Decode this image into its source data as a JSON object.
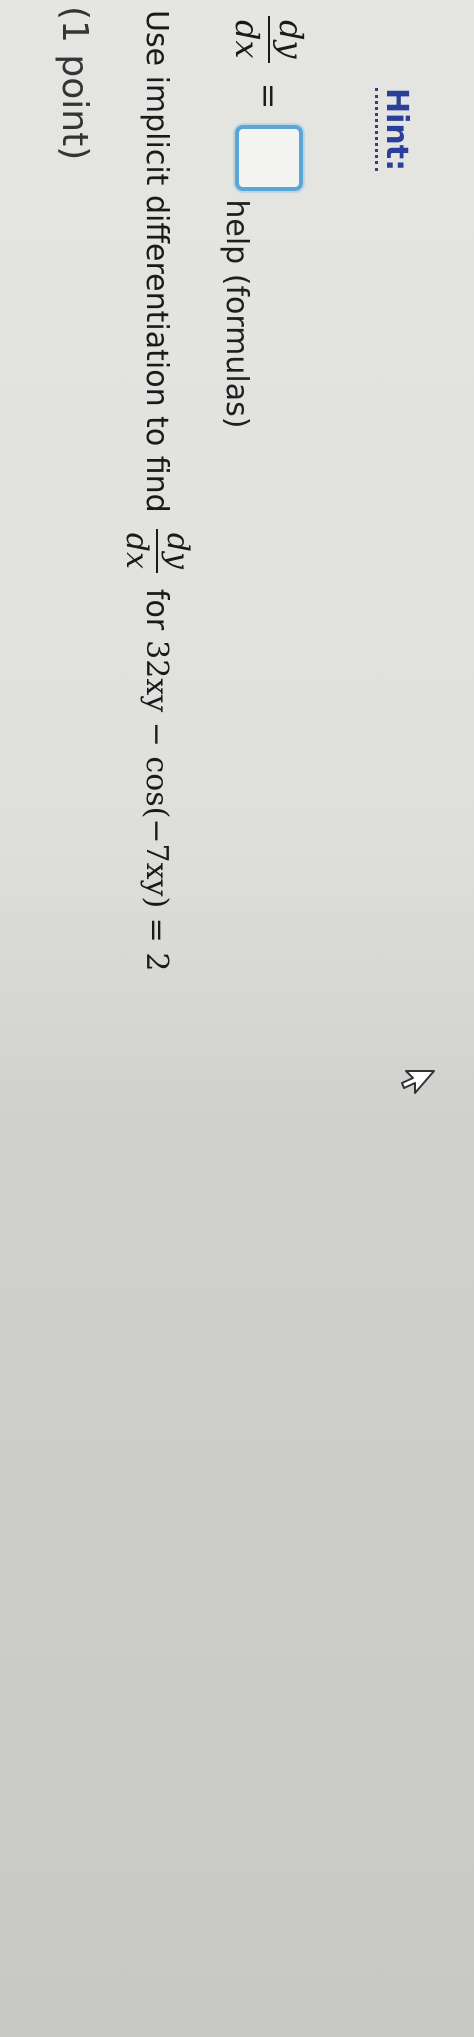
{
  "problem": {
    "point_label": "(1 point)",
    "instruction_prefix": "Use implicit differentiation to find",
    "fraction": {
      "numerator": "dy",
      "denominator": "dx"
    },
    "instruction_middle": "for",
    "equation": "32xy − cos(−7xy) = 2"
  },
  "answer": {
    "lhs_fraction": {
      "numerator": "dy",
      "denominator": "dx"
    },
    "equals": "=",
    "input_value": "",
    "help_link": "help (formulas)"
  },
  "hint": {
    "label": "Hint:"
  },
  "icons": {
    "cursor": "mouse-pointer-icon"
  },
  "colors": {
    "answer_box_border": "#5aa6d8",
    "hint_link": "#2a3f9a",
    "background": "#d9d9d6"
  }
}
